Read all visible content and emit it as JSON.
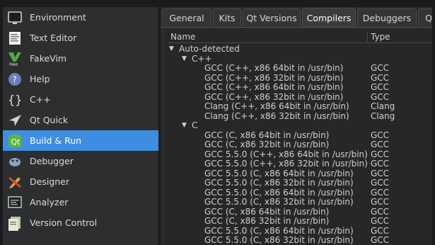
{
  "sidebar": {
    "items": [
      {
        "label": "Environment",
        "icon": "monitor-icon"
      },
      {
        "label": "Text Editor",
        "icon": "text-editor-icon"
      },
      {
        "label": "FakeVim",
        "icon": "fakevim-icon"
      },
      {
        "label": "Help",
        "icon": "help-icon"
      },
      {
        "label": "C++",
        "icon": "braces-icon"
      },
      {
        "label": "Qt Quick",
        "icon": "qt-quick-icon"
      },
      {
        "label": "Build & Run",
        "icon": "build-run-icon"
      },
      {
        "label": "Debugger",
        "icon": "debugger-icon"
      },
      {
        "label": "Designer",
        "icon": "designer-icon"
      },
      {
        "label": "Analyzer",
        "icon": "analyzer-icon"
      },
      {
        "label": "Version Control",
        "icon": "version-control-icon"
      }
    ],
    "active_index": 6,
    "active_color": "#3d8ee0"
  },
  "tabs": [
    "General",
    "Kits",
    "Qt Versions",
    "Compilers",
    "Debuggers",
    "Q"
  ],
  "active_tab": "Compilers",
  "table": {
    "col_name": "Name",
    "col_type": "Type",
    "root": "Auto-detected",
    "groups": [
      {
        "name": "C++",
        "rows": [
          {
            "name": "GCC (C++, x86 64bit in /usr/bin)",
            "type": "GCC"
          },
          {
            "name": "GCC (C++, x86 32bit in /usr/bin)",
            "type": "GCC"
          },
          {
            "name": "GCC (C++, x86 64bit in /usr/bin)",
            "type": "GCC"
          },
          {
            "name": "GCC (C++, x86 32bit in /usr/bin)",
            "type": "GCC"
          },
          {
            "name": "Clang (C++, x86 64bit in /usr/bin)",
            "type": "Clang"
          },
          {
            "name": "Clang (C++, x86 32bit in /usr/bin)",
            "type": "Clang"
          }
        ]
      },
      {
        "name": "C",
        "rows": [
          {
            "name": "GCC (C, x86 64bit in /usr/bin)",
            "type": "GCC"
          },
          {
            "name": "GCC (C, x86 32bit in /usr/bin)",
            "type": "GCC"
          },
          {
            "name": "GCC 5.5.0 (C++, x86 64bit in /usr/bin)",
            "type": "GCC"
          },
          {
            "name": "GCC 5.5.0 (C++, x86 32bit in /usr/bin)",
            "type": "GCC"
          },
          {
            "name": "GCC 5.5.0 (C, x86 64bit in /usr/bin)",
            "type": "GCC"
          },
          {
            "name": "GCC 5.5.0 (C, x86 32bit in /usr/bin)",
            "type": "GCC"
          },
          {
            "name": "GCC 5.5.0 (C, x86 64bit in /usr/bin)",
            "type": "GCC"
          },
          {
            "name": "GCC 5.5.0 (C, x86 32bit in /usr/bin)",
            "type": "GCC"
          },
          {
            "name": "GCC (C, x86 64bit in /usr/bin)",
            "type": "GCC"
          },
          {
            "name": "GCC (C, x86 32bit in /usr/bin)",
            "type": "GCC"
          },
          {
            "name": "GCC 5.5.0 (C, x86 64bit in /usr/bin)",
            "type": "GCC"
          },
          {
            "name": "GCC 5.5.0 (C, x86 32bit in /usr/bin)",
            "type": "GCC"
          }
        ]
      }
    ]
  }
}
